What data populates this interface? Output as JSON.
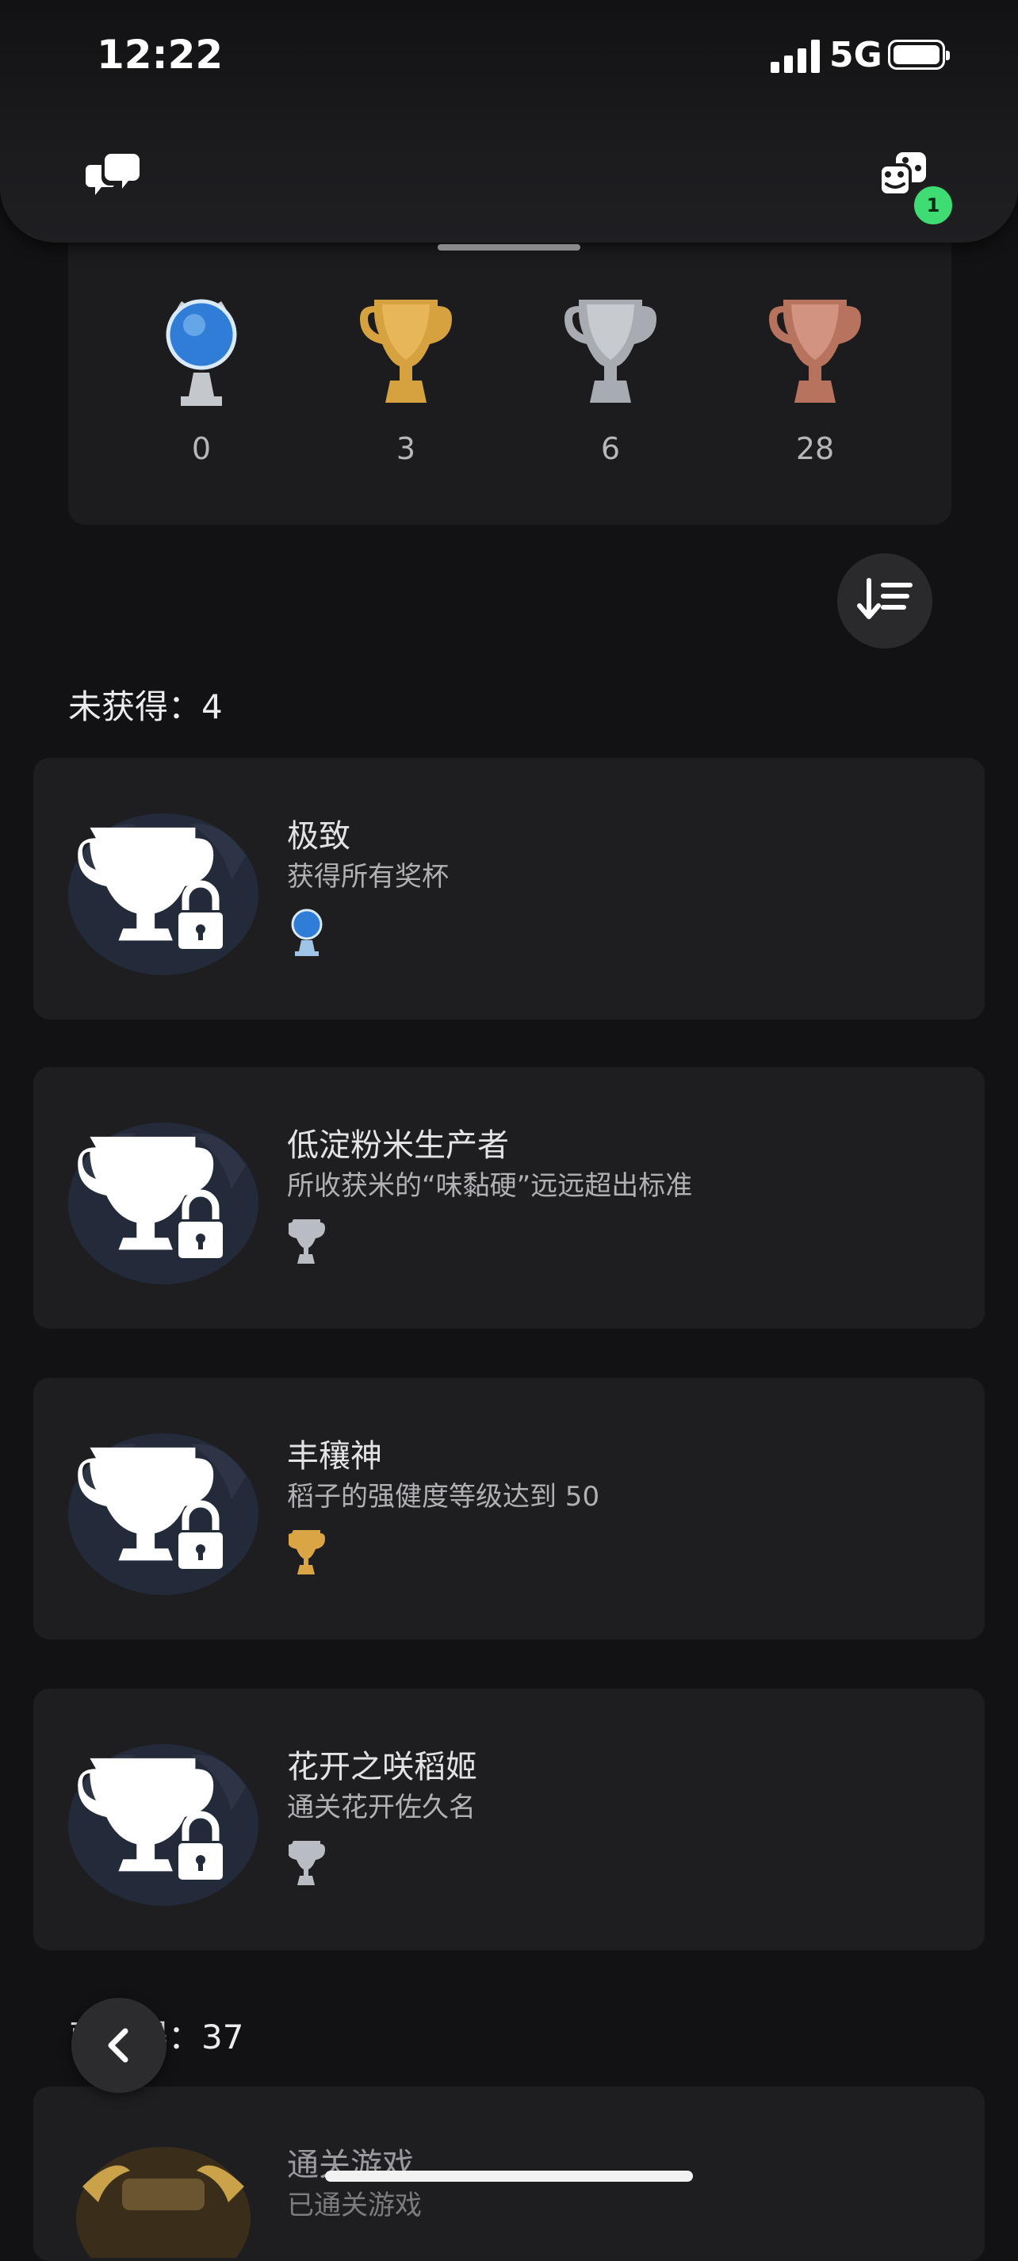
{
  "status_bar": {
    "time": "12:22",
    "network": "5G"
  },
  "header": {
    "notification_badge": "1"
  },
  "summary": {
    "platinum": "0",
    "gold": "3",
    "silver": "6",
    "bronze": "28"
  },
  "sections": {
    "unearned_label": "未获得：4",
    "earned_label": "已获得：37"
  },
  "trophies": [
    {
      "title": "极致",
      "desc": "获得所有奖杯",
      "grade": "platinum"
    },
    {
      "title": "低淀粉米生产者",
      "desc": "所收获米的“味黏硬”远远超出标准",
      "grade": "silver"
    },
    {
      "title": "丰穰神",
      "desc": "稻子的强健度等级达到 50",
      "grade": "gold"
    },
    {
      "title": "花开之咲稻姬",
      "desc": "通关花开佐久名",
      "grade": "silver"
    }
  ],
  "earned_preview": {
    "title": "通关游戏",
    "desc": "已通关游戏"
  },
  "colors": {
    "platinum": "#9fc4e8",
    "gold": "#d9a545",
    "silver": "#b9bcc2",
    "bronze": "#c98672",
    "badge": "#3fdc73"
  }
}
